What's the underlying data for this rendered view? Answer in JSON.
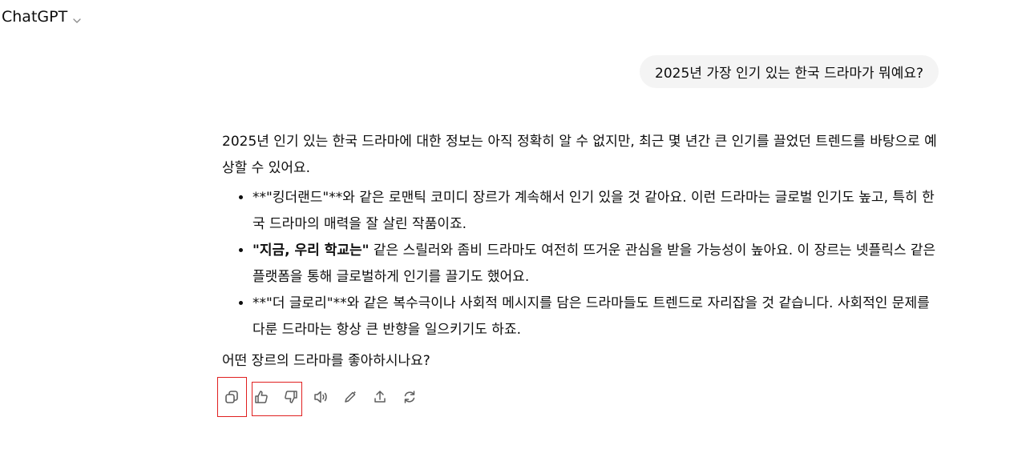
{
  "header": {
    "model_name": "ChatGPT",
    "chevron_icon": "chevron-down-icon"
  },
  "user_message": {
    "text": "2025년 가장 인기 있는 한국 드라마가 뭐예요?"
  },
  "assistant_message": {
    "intro": "2025년 인기 있는 한국 드라마에 대한 정보는 아직 정확히 알 수 없지만, 최근 몇 년간 큰 인기를 끌었던 트렌드를 바탕으로 예상할 수 있어요.",
    "bullets": [
      {
        "bold": "",
        "prefix": "**\"킹더랜드\"**와 같은 로맨틱 코미디 장르가 계속해서 인기 있을 것 같아요. 이런 드라마는 글로벌 인기도 높고, 특히 한국 드라마의 매력을 잘 살린 작품이죠."
      },
      {
        "bold": "\"지금, 우리 학교는\"",
        "prefix": " 같은 스릴러와 좀비 드라마도 여전히 뜨거운 관심을 받을 가능성이 높아요. 이 장르는 넷플릭스 같은 플랫폼을 통해 글로벌하게 인기를 끌기도 했어요."
      },
      {
        "bold": "",
        "prefix": "**\"더 글로리\"**와 같은 복수극이나 사회적 메시지를 담은 드라마들도 트렌드로 자리잡을 것 같습니다. 사회적인 문제를 다룬 드라마는 항상 큰 반향을 일으키기도 하죠."
      }
    ],
    "question": "어떤 장르의 드라마를 좋아하시나요?"
  },
  "actions": [
    {
      "name": "copy-icon"
    },
    {
      "name": "thumbs-up-icon"
    },
    {
      "name": "thumbs-down-icon"
    },
    {
      "name": "read-aloud-icon"
    },
    {
      "name": "edit-icon"
    },
    {
      "name": "share-icon"
    },
    {
      "name": "regenerate-icon"
    }
  ],
  "colors": {
    "highlight_box": "#e02020",
    "bubble_bg": "#f4f4f4",
    "icon": "#5d5d5d"
  }
}
